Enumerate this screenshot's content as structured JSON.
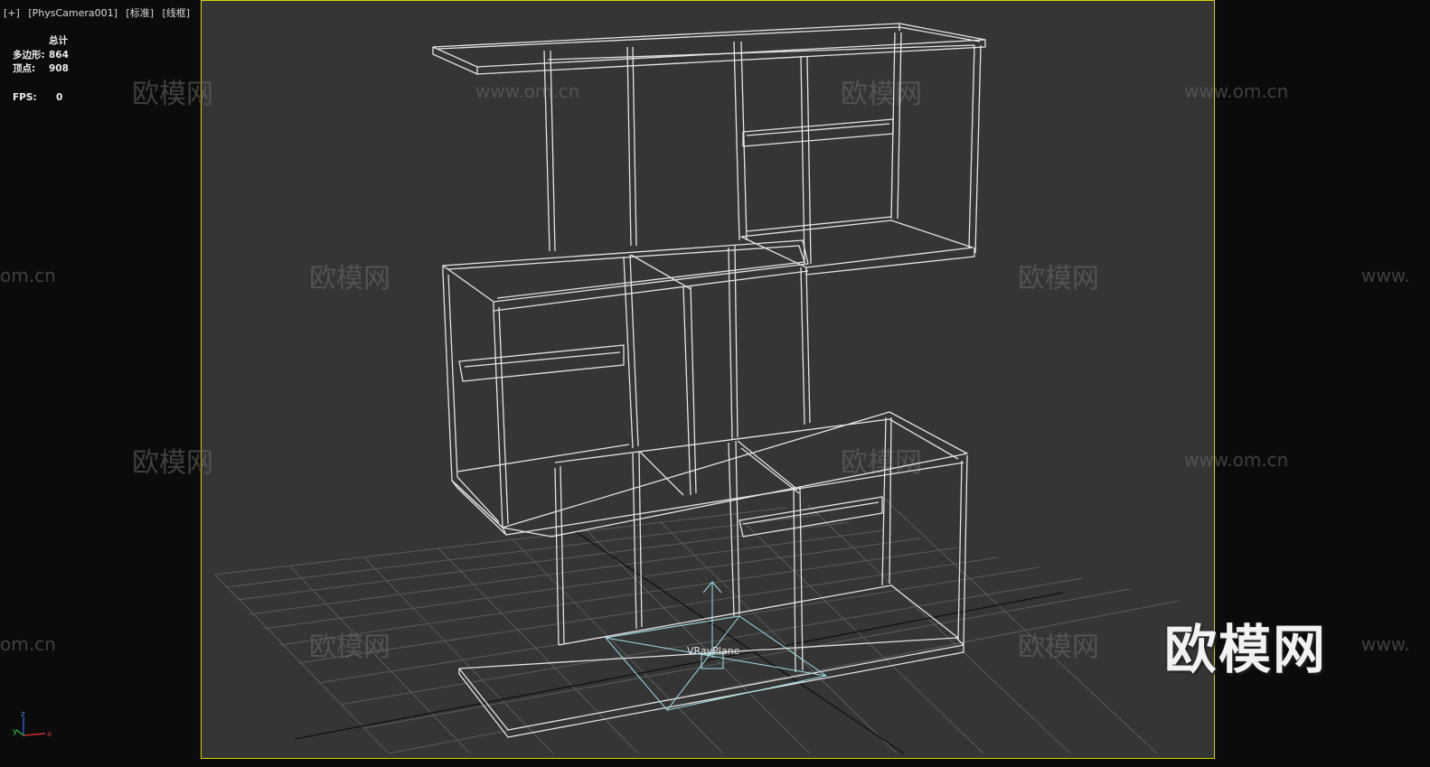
{
  "viewport_label": {
    "plus": "[+]",
    "camera": "[PhysCamera001]",
    "shading": "[标准]",
    "mode": "[线框]"
  },
  "stats": {
    "header": "总计",
    "polygons_label": "多边形:",
    "polygons_value": "864",
    "vertices_label": "顶点:",
    "vertices_value": "908",
    "fps_label": "FPS:",
    "fps_value": "0"
  },
  "watermarks": {
    "text_cn": "欧模网",
    "text_url": "www.om.cn",
    "text_url_partial": "om.cn",
    "text_url_left": "www."
  },
  "object_label": "VRayPlane",
  "brand_logo": "欧模网",
  "axis_labels": {
    "x": "x",
    "y": "y",
    "z": "z"
  },
  "colors": {
    "frame": "#d6d600",
    "viewport_bg": "#353535",
    "wireframe": "#e4e4e4",
    "vray_plane": "#9fe0e6",
    "grid": "#5a5a5a"
  }
}
